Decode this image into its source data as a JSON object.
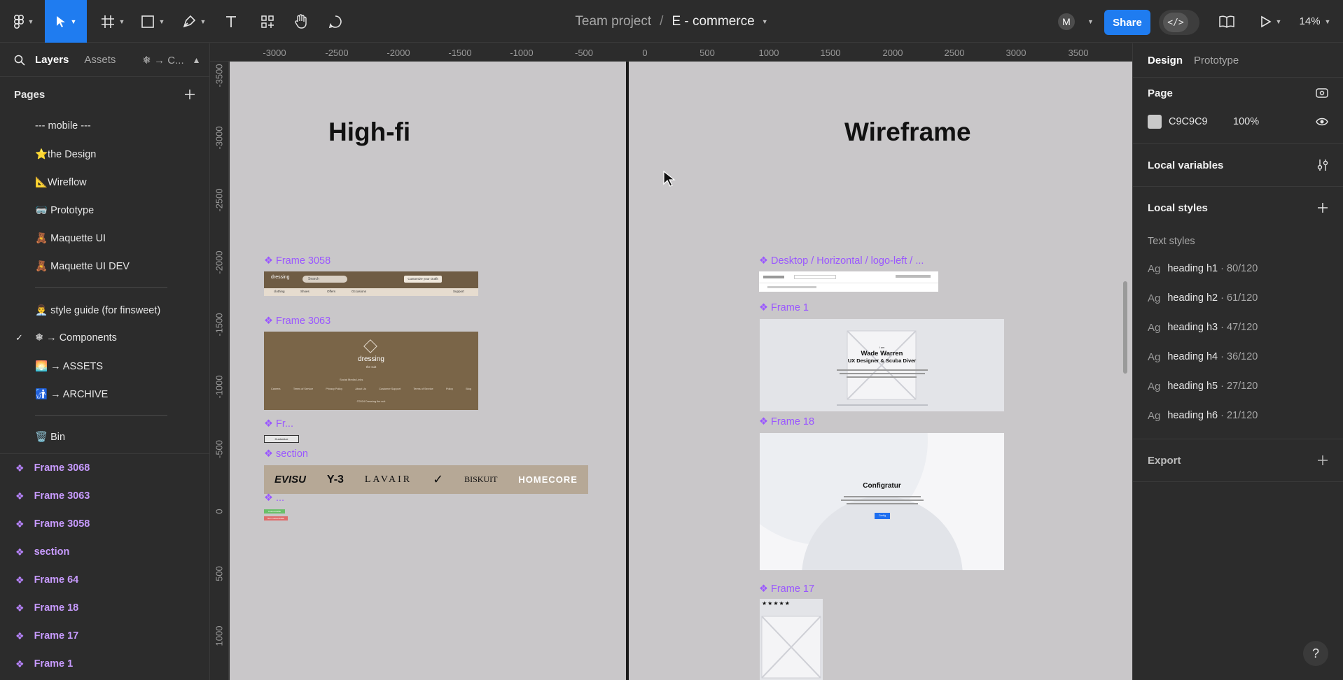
{
  "toolbar": {
    "project": "Team project",
    "separator": "/",
    "file_name": "E - commerce",
    "avatar_initial": "M",
    "share_label": "Share",
    "dev_mode_icon": "</>",
    "zoom": "14%"
  },
  "left_panel": {
    "tabs": [
      "Layers",
      "Assets"
    ],
    "component_tab": "❅ → C...",
    "pages_title": "Pages",
    "pages": [
      {
        "label": "--- mobile ---"
      },
      {
        "label": "⭐the Design"
      },
      {
        "label": "📐Wireflow"
      },
      {
        "label": "🥽 Prototype"
      },
      {
        "label": "🧸 Maquette UI"
      },
      {
        "label": "🧸 Maquette UI DEV"
      },
      {
        "label": "👨‍💼 style guide (for finsweet)"
      },
      {
        "label": "❅ → Components",
        "selected": true
      },
      {
        "label": "🌅 → ASSETS"
      },
      {
        "label": "🚮 → ARCHIVE"
      },
      {
        "label": "🗑️ Bin"
      }
    ],
    "layers": [
      "Frame 3068",
      "Frame 3063",
      "Frame 3058",
      "section",
      "Frame 64",
      "Frame 18",
      "Frame 17",
      "Frame 1"
    ],
    "check_mark": "✓"
  },
  "rulers": {
    "top": [
      "-3000",
      "-2500",
      "-2000",
      "-1500",
      "-1000",
      "-500",
      "0",
      "500",
      "1000",
      "1500",
      "2000",
      "2500",
      "3000",
      "3500"
    ],
    "left": [
      "-3500",
      "-3000",
      "-2500",
      "-2000",
      "-1500",
      "-1000",
      "-500",
      "0",
      "500",
      "1000"
    ]
  },
  "canvas": {
    "background": "#C9C7C9",
    "section_left": "High-fi",
    "section_right": "Wireframe",
    "frames": {
      "f3058": "Frame 3058",
      "f3063": "Frame 3063",
      "fr": "Fr...",
      "section": "section",
      "dots": "...",
      "desktop": "Desktop / Horizontal / logo-left / ...",
      "frame1": "Frame 1",
      "frame18": "Frame 18",
      "frame17": "Frame 17"
    },
    "thumbnails": {
      "nav_logo": "dressing",
      "nav_search": "Search",
      "nav_cta": "Customize your Outfit",
      "nav_links": [
        "clothing",
        "Shoes",
        "Offers",
        "Occasions"
      ],
      "nav_support": "Support",
      "footer_logo": "dressing",
      "footer_tagline": "the suit",
      "footer_social_label": "Social Media Links",
      "footer_links": [
        "Careers",
        "Terms of Service",
        "Privacy Policy",
        "About Us",
        "Customer Support",
        "Terms of Service",
        "Policy",
        "Blog"
      ],
      "footer_copy": "©2024 Dressing the suit",
      "customize_btn": "Customize",
      "brands": [
        "EVISU",
        "Y-3",
        "LAVAIR",
        "✓",
        "BISKUIT",
        "HOMECORE"
      ],
      "tag_green": "Customizable",
      "tag_red": "Non customizable",
      "hero_small": "I am",
      "hero_name": "Wade Warren",
      "hero_role": "UX Designer & Scuba Diver",
      "config_title": "Configratur",
      "config_btn": "Config",
      "stars": "★★★★★"
    }
  },
  "right_panel": {
    "tabs": [
      "Design",
      "Prototype"
    ],
    "page_title": "Page",
    "page_color": "C9C9C9",
    "page_opacity": "100%",
    "local_variables": "Local variables",
    "local_styles": "Local styles",
    "text_styles_title": "Text styles",
    "text_styles": [
      {
        "ag": "Ag",
        "name": "heading h1",
        "spec": "· 80/120"
      },
      {
        "ag": "Ag",
        "name": "heading h2",
        "spec": "· 61/120"
      },
      {
        "ag": "Ag",
        "name": "heading h3",
        "spec": "· 47/120"
      },
      {
        "ag": "Ag",
        "name": "heading h4",
        "spec": "· 36/120"
      },
      {
        "ag": "Ag",
        "name": "heading h5",
        "spec": "· 27/120"
      },
      {
        "ag": "Ag",
        "name": "heading h6",
        "spec": "· 21/120"
      }
    ],
    "export": "Export"
  },
  "help": "?"
}
